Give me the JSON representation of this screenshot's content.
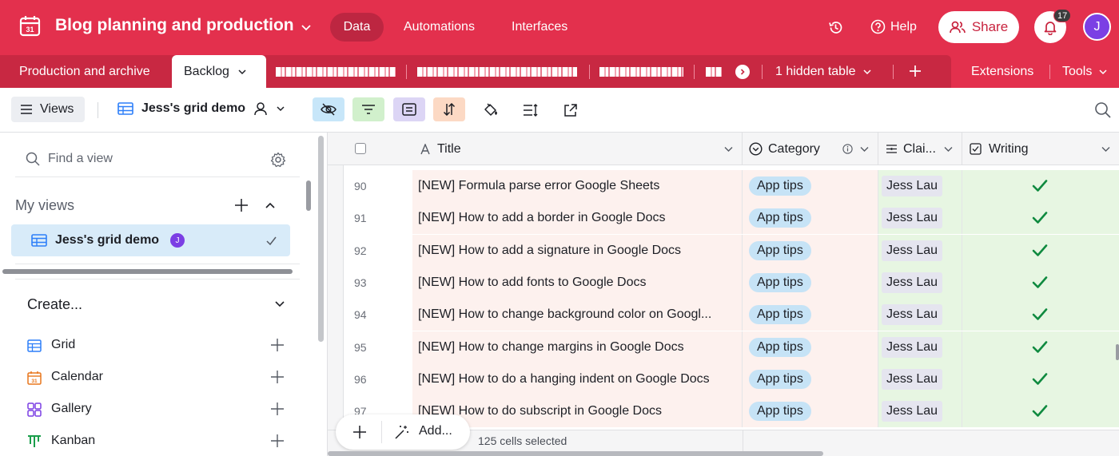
{
  "topbar": {
    "base_name": "Blog planning and production",
    "nav": [
      "Data",
      "Automations",
      "Interfaces"
    ],
    "help": "Help",
    "share": "Share",
    "notifications": "17",
    "avatar": "J"
  },
  "tabs": {
    "production": "Production and archive",
    "backlog": "Backlog",
    "hidden": "1 hidden table",
    "extensions": "Extensions",
    "tools": "Tools"
  },
  "viewbar": {
    "views": "Views",
    "view_name": "Jess's grid demo"
  },
  "sidebar": {
    "find_placeholder": "Find a view",
    "my_views": "My views",
    "current_view": "Jess's grid demo",
    "current_view_avatar": "J",
    "create": "Create...",
    "create_items": [
      "Grid",
      "Calendar",
      "Gallery",
      "Kanban"
    ]
  },
  "grid": {
    "headers": [
      "Title",
      "Category",
      "Clai...",
      "Writing"
    ],
    "rows": [
      {
        "num": "90",
        "title": "[NEW] Formula parse error Google Sheets",
        "category": "App tips",
        "claimed": "Jess Lau",
        "writing": true
      },
      {
        "num": "91",
        "title": "[NEW] How to add a border in Google Docs",
        "category": "App tips",
        "claimed": "Jess Lau",
        "writing": true
      },
      {
        "num": "92",
        "title": "[NEW] How to add a signature in Google Docs",
        "category": "App tips",
        "claimed": "Jess Lau",
        "writing": true
      },
      {
        "num": "93",
        "title": "[NEW] How to add fonts to Google Docs",
        "category": "App tips",
        "claimed": "Jess Lau",
        "writing": true
      },
      {
        "num": "94",
        "title": "[NEW] How to change background color on Googl...",
        "category": "App tips",
        "claimed": "Jess Lau",
        "writing": true
      },
      {
        "num": "95",
        "title": "[NEW] How to change margins in Google Docs",
        "category": "App tips",
        "claimed": "Jess Lau",
        "writing": true
      },
      {
        "num": "96",
        "title": "[NEW] How to do a hanging indent on Google Docs",
        "category": "App tips",
        "claimed": "Jess Lau",
        "writing": true
      },
      {
        "num": "97",
        "title": "[NEW] How to do subscript in Google Docs",
        "category": "App tips",
        "claimed": "Jess Lau",
        "writing": true
      }
    ],
    "add_label": "Add...",
    "cells_selected": "125 cells selected"
  },
  "colors": {
    "brand": "#e3304d",
    "title_bg": "#fdf1ee",
    "writing_bg": "#e7f6e2",
    "pill": "#c6e3f6",
    "check": "#0f8a3f"
  }
}
